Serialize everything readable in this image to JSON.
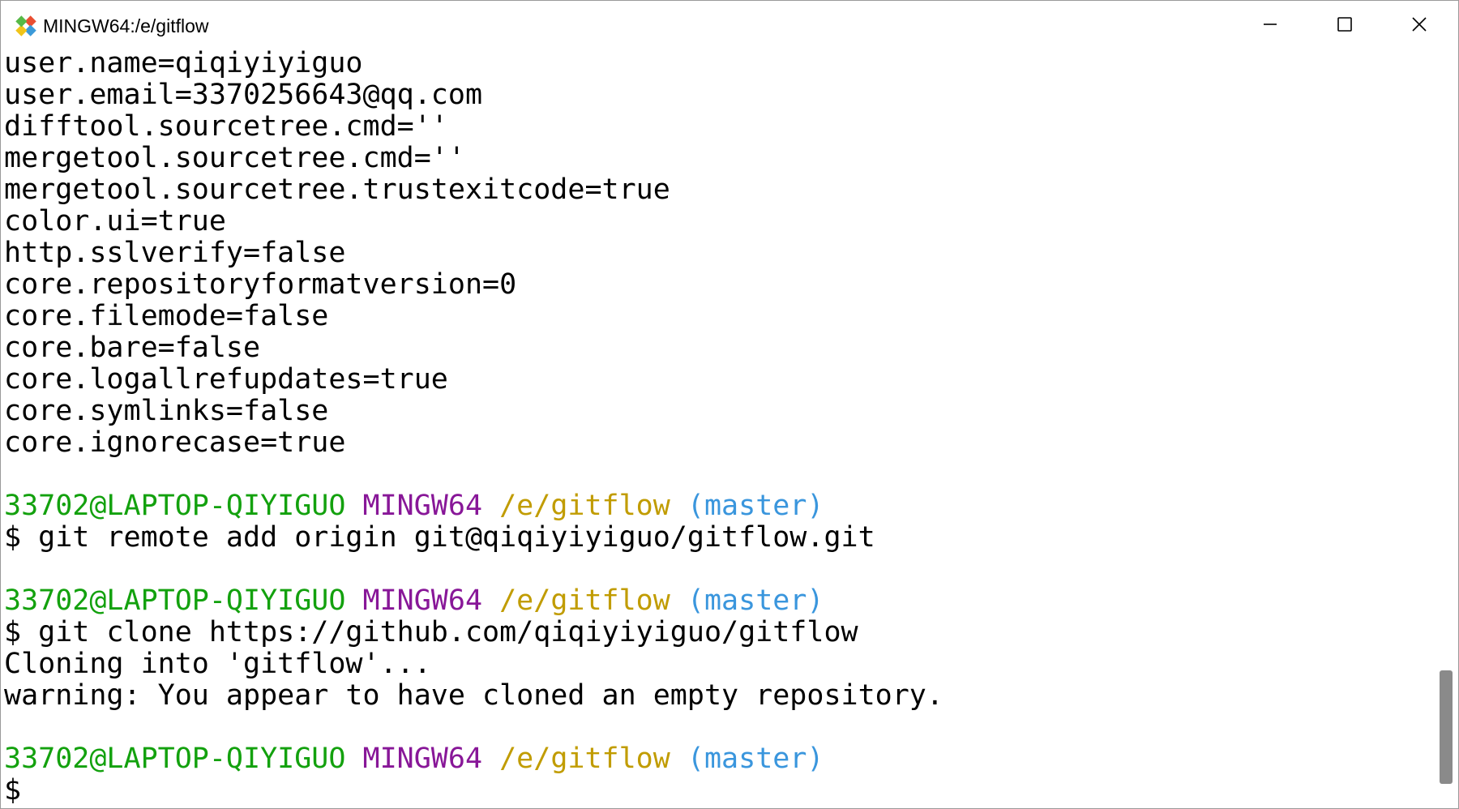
{
  "window": {
    "title": "MINGW64:/e/gitflow",
    "icon": "git-logo-icon",
    "controls": {
      "minimize_icon": "minimize-icon",
      "maximize_icon": "maximize-icon",
      "close_icon": "close-icon"
    }
  },
  "colors": {
    "user_host": "#13a10e",
    "shell": "#881798",
    "path": "#c19c00",
    "branch": "#3a96dd",
    "text": "#000000",
    "background": "#ffffff"
  },
  "terminal": {
    "config_lines": [
      "user.name=qiqiyiyiguo",
      "user.email=3370256643@qq.com",
      "difftool.sourcetree.cmd=''",
      "mergetool.sourcetree.cmd=''",
      "mergetool.sourcetree.trustexitcode=true",
      "color.ui=true",
      "http.sslverify=false",
      "core.repositoryformatversion=0",
      "core.filemode=false",
      "core.bare=false",
      "core.logallrefupdates=true",
      "core.symlinks=false",
      "core.ignorecase=true"
    ],
    "prompts": [
      {
        "user": "33702@LAPTOP-QIYIGUO",
        "shell": "MINGW64",
        "path": "/e/gitflow",
        "branch": "(master)",
        "command": "$ git remote add origin git@qiqiyiyiguo/gitflow.git",
        "output": []
      },
      {
        "user": "33702@LAPTOP-QIYIGUO",
        "shell": "MINGW64",
        "path": "/e/gitflow",
        "branch": "(master)",
        "command": "$ git clone https://github.com/qiqiyiyiguo/gitflow",
        "output": [
          "Cloning into 'gitflow'...",
          "warning: You appear to have cloned an empty repository."
        ]
      },
      {
        "user": "33702@LAPTOP-QIYIGUO",
        "shell": "MINGW64",
        "path": "/e/gitflow",
        "branch": "(master)",
        "command": "$",
        "output": []
      }
    ]
  },
  "scrollbar": {
    "position_fraction": 0.97
  }
}
